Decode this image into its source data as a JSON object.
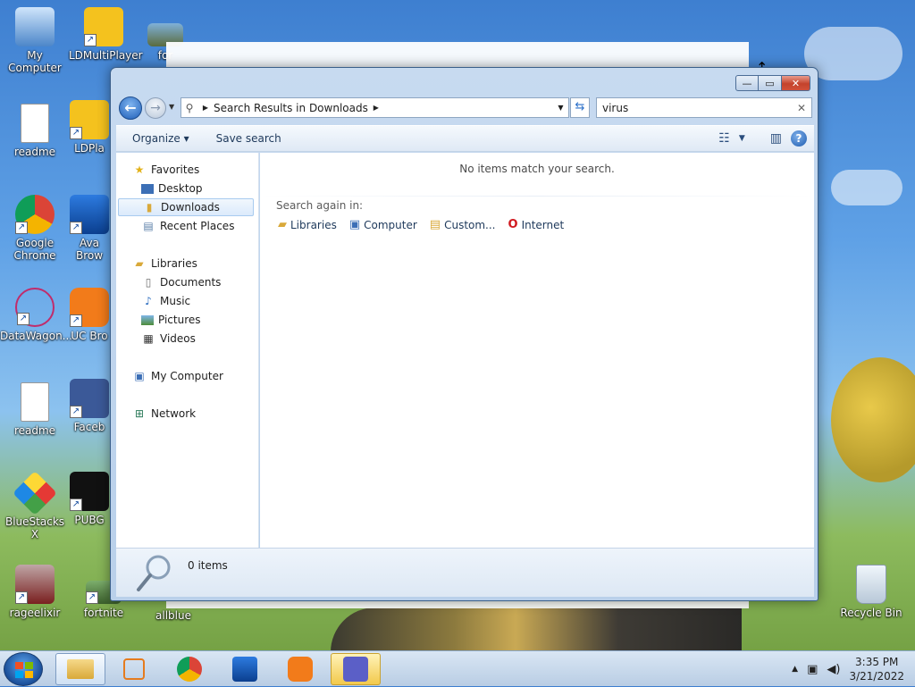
{
  "desktop": {
    "icons": [
      {
        "label": "My Computer"
      },
      {
        "label": "LDMultiPlayer"
      },
      {
        "label": "for"
      },
      {
        "label": "readme"
      },
      {
        "label": "LDPla"
      },
      {
        "label": "Google Chrome"
      },
      {
        "label": "Ava Brow"
      },
      {
        "label": "DataWagon..."
      },
      {
        "label": "UC Bro"
      },
      {
        "label": "readme"
      },
      {
        "label": "Faceb"
      },
      {
        "label": "BlueStacks X"
      },
      {
        "label": "PUBG"
      },
      {
        "label": "rageelixir"
      },
      {
        "label": "fortnite"
      },
      {
        "label": "allblue"
      },
      {
        "label": "Recycle Bin"
      }
    ]
  },
  "window": {
    "caption_buttons": {
      "minimize": "—",
      "maximize": "▭",
      "close": "✕"
    },
    "address": {
      "crumb": "Search Results in Downloads"
    },
    "search": {
      "value": "virus"
    },
    "toolbar": {
      "organize": "Organize ▾",
      "save_search": "Save search"
    },
    "nav": {
      "favorites": "Favorites",
      "desktop": "Desktop",
      "downloads": "Downloads",
      "recent": "Recent Places",
      "libraries": "Libraries",
      "documents": "Documents",
      "music": "Music",
      "pictures": "Pictures",
      "videos": "Videos",
      "my_computer": "My Computer",
      "network": "Network"
    },
    "content": {
      "no_items": "No items match your search.",
      "search_again": "Search again in:",
      "links": {
        "libraries": "Libraries",
        "computer": "Computer",
        "custom": "Custom...",
        "internet": "Internet"
      }
    },
    "details": {
      "count": "0 items"
    }
  },
  "taskbar": {
    "time": "3:35 PM",
    "date": "3/21/2022"
  },
  "colors": {
    "accent": "#1f5fb8",
    "close_red": "#c4432c",
    "highlight": "#f2c94c"
  }
}
